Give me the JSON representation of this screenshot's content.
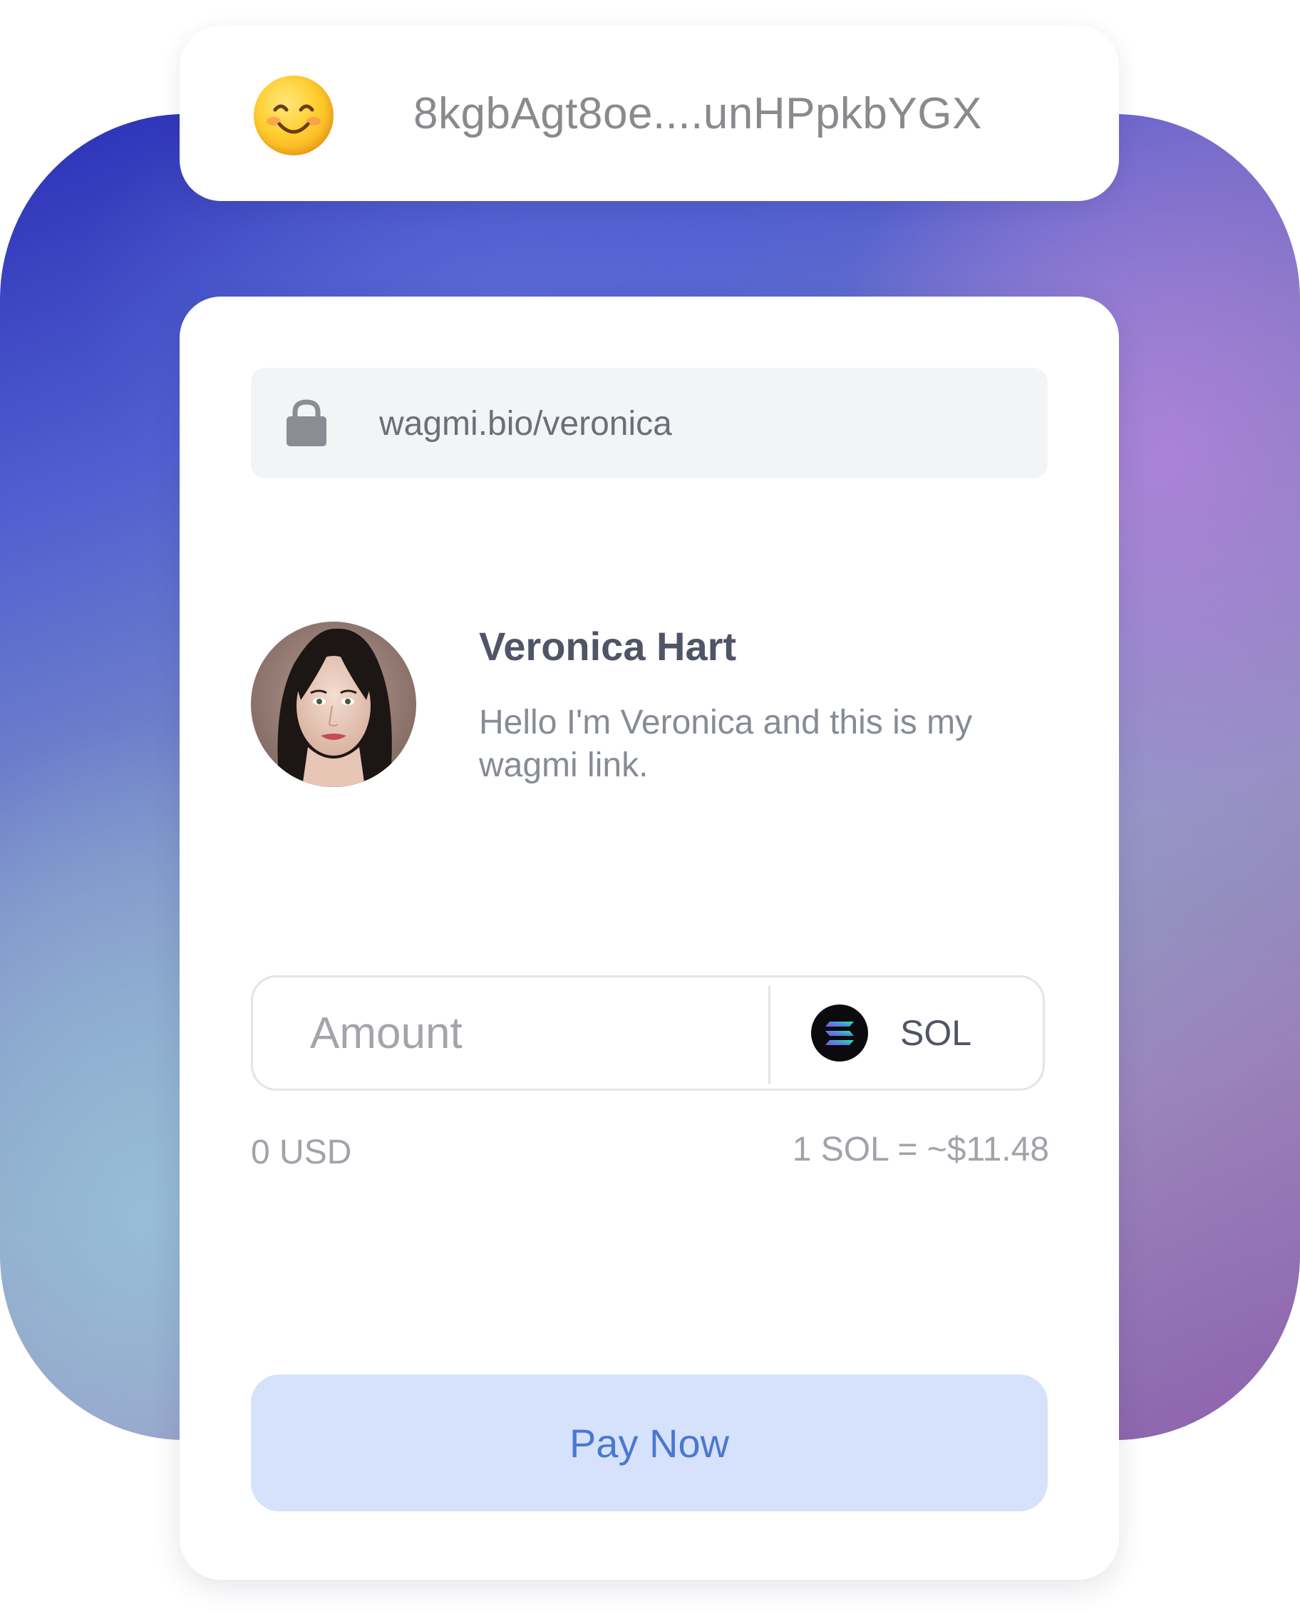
{
  "wallet": {
    "avatar_icon": "smiling-face-emoji",
    "address": "8kgbAgt8oe....unHPpkbYGX"
  },
  "profile": {
    "url_icon": "lock-icon",
    "url": "wagmi.bio/veronica",
    "name": "Veronica Hart",
    "bio": "Hello I'm Veronica and this is my wagmi link."
  },
  "payment": {
    "amount_placeholder": "Amount",
    "amount_value": "",
    "currency_icon": "solana-icon",
    "currency": "SOL",
    "usd_value": "0 USD",
    "rate": "1 SOL = ~$11.48",
    "pay_label": "Pay Now"
  },
  "colors": {
    "accent": "#4a78d0",
    "button_bg": "#d6e2fb"
  }
}
